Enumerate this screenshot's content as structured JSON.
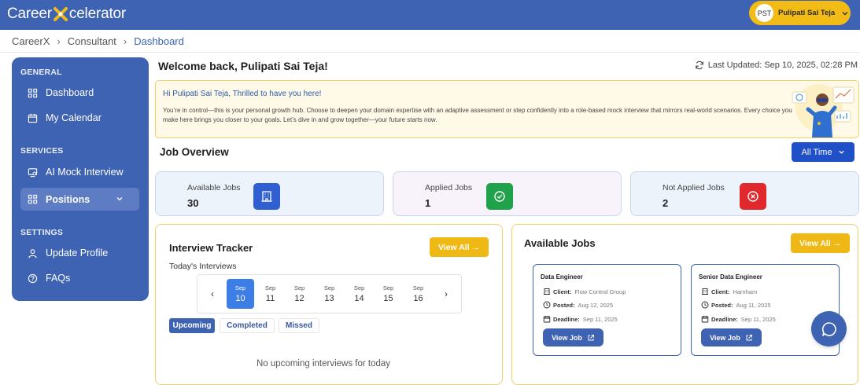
{
  "header": {
    "logo_left": "Career",
    "logo_right": "celerator",
    "user_initials": "PST",
    "user_name": "Pulipati Sai Teja"
  },
  "breadcrumb": [
    "CareerX",
    "Consultant",
    "Dashboard"
  ],
  "sidebar": {
    "sections": [
      {
        "title": "GENERAL",
        "items": [
          {
            "label": "Dashboard",
            "icon": "grid-icon"
          },
          {
            "label": "My Calendar",
            "icon": "calendar-icon"
          }
        ]
      },
      {
        "title": "SERVICES",
        "items": [
          {
            "label": "AI Mock Interview",
            "icon": "ai-screen-icon"
          },
          {
            "label": "Positions",
            "icon": "grid-icon",
            "active": true
          }
        ]
      },
      {
        "title": "SETTINGS",
        "items": [
          {
            "label": "Update Profile",
            "icon": "user-icon"
          },
          {
            "label": "FAQs",
            "icon": "help-icon"
          }
        ]
      }
    ]
  },
  "main": {
    "welcome": "Welcome back, Pulipati Sai Teja!",
    "last_updated": "Last Updated: Sep 10, 2025, 02:28 PM",
    "banner": {
      "title": "Hi Pulipati Sai Teja, Thrilled to have you here!",
      "body": "You’re in control—this is your personal growth hub. Choose to deepen your domain expertise with an adaptive assessment or step confidently into a role-based mock interview that mirrors real-world scenarios. Every choice you make here brings you closer to your goals. Let’s dive in and grow together—your future starts now."
    },
    "job_overview": {
      "title": "Job Overview",
      "filter": "All Time",
      "stats": [
        {
          "label": "Available Jobs",
          "value": "30",
          "color": "#2f5fd0",
          "icon": "building-icon"
        },
        {
          "label": "Applied Jobs",
          "value": "1",
          "color": "#1fa24a",
          "icon": "check-circle-icon"
        },
        {
          "label": "Not Applied Jobs",
          "value": "2",
          "color": "#e0282d",
          "icon": "x-circle-icon"
        }
      ]
    },
    "interview_tracker": {
      "title": "Interview Tracker",
      "view_all": "View All →",
      "today_label": "Today's Interviews",
      "days": [
        {
          "month": "Sep",
          "day": "10",
          "selected": true
        },
        {
          "month": "Sep",
          "day": "11"
        },
        {
          "month": "Sep",
          "day": "12"
        },
        {
          "month": "Sep",
          "day": "13"
        },
        {
          "month": "Sep",
          "day": "14"
        },
        {
          "month": "Sep",
          "day": "15"
        },
        {
          "month": "Sep",
          "day": "16"
        }
      ],
      "prev": "‹",
      "next": "›",
      "tabs": [
        "Upcoming",
        "Completed",
        "Missed"
      ],
      "empty_text": "No upcoming interviews for today"
    },
    "available_jobs": {
      "title": "Available Jobs",
      "view_all": "View All →",
      "jobs": [
        {
          "title": "Data Engineer",
          "client_label": "Client:",
          "client": "Flow Control Group",
          "posted_label": "Posted:",
          "posted": "Aug 12, 2025",
          "deadline_label": "Deadline:",
          "deadline": "Sep 11, 2025",
          "button": "View Job"
        },
        {
          "title": "Senior Data Engineer",
          "client_label": "Client:",
          "client": "Harnham",
          "posted_label": "Posted:",
          "posted": "Aug 11, 2025",
          "deadline_label": "Deadline:",
          "deadline": "Sep 11, 2025",
          "button": "View Job"
        }
      ]
    }
  },
  "colors": {
    "primary": "#3f63b3",
    "accent": "#f0b814",
    "blue_button": "#2050c8"
  }
}
